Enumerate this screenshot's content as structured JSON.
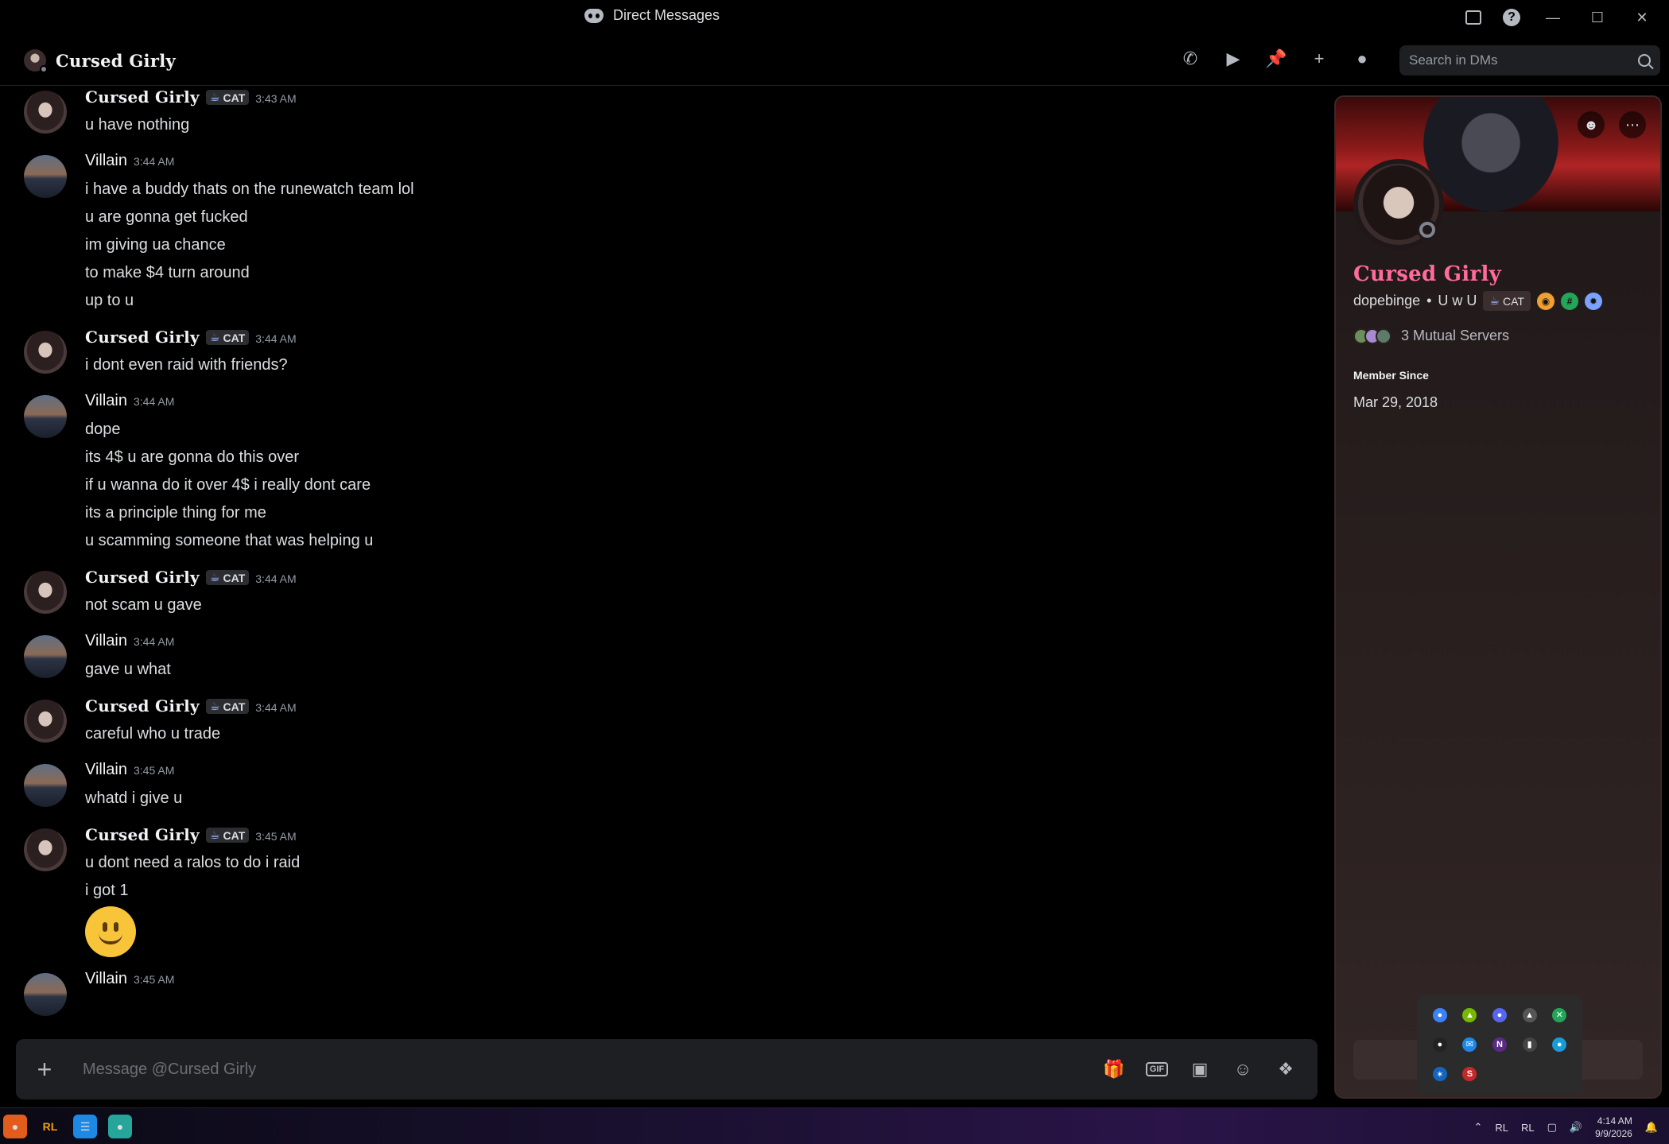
{
  "window": {
    "title": "Direct Messages"
  },
  "header": {
    "name": "Cursed Girly",
    "search_placeholder": "Search in DMs"
  },
  "messages": [
    {
      "author": "Cursed Girly",
      "kind": "cursed",
      "tag": "CAT",
      "time": "3:43 AM",
      "lines": [
        "u have nothing"
      ]
    },
    {
      "author": "Villain",
      "kind": "villain",
      "time": "3:44 AM",
      "lines": [
        "i have a buddy thats on the runewatch team lol",
        "u are gonna get fucked",
        "im giving ua chance",
        "to make $4 turn around",
        "up to u"
      ]
    },
    {
      "author": "Cursed Girly",
      "kind": "cursed",
      "tag": "CAT",
      "time": "3:44 AM",
      "lines": [
        "i dont even raid with friends?"
      ]
    },
    {
      "author": "Villain",
      "kind": "villain",
      "time": "3:44 AM",
      "lines": [
        "dope",
        "its 4$ u are gonna do this over",
        "if u wanna do it over 4$ i really dont care",
        "its a principle thing for me",
        "u scamming someone that was helping u"
      ]
    },
    {
      "author": "Cursed Girly",
      "kind": "cursed",
      "tag": "CAT",
      "time": "3:44 AM",
      "lines": [
        "not scam u gave"
      ]
    },
    {
      "author": "Villain",
      "kind": "villain",
      "time": "3:44 AM",
      "lines": [
        "gave u what"
      ]
    },
    {
      "author": "Cursed Girly",
      "kind": "cursed",
      "tag": "CAT",
      "time": "3:44 AM",
      "lines": [
        "careful who u trade"
      ]
    },
    {
      "author": "Villain",
      "kind": "villain",
      "time": "3:45 AM",
      "lines": [
        "whatd i give u"
      ]
    },
    {
      "author": "Cursed Girly",
      "kind": "cursed",
      "tag": "CAT",
      "time": "3:45 AM",
      "lines": [
        "u dont need a ralos to do i raid",
        "i got 1"
      ],
      "emoji": "slightly-smiling-face"
    },
    {
      "author": "Villain",
      "kind": "villain",
      "time": "3:45 AM",
      "lines": []
    }
  ],
  "composer": {
    "placeholder": "Message @Cursed Girly",
    "gif_label": "GIF"
  },
  "profile": {
    "display_name": "Cursed Girly",
    "username": "dopebinge",
    "pronouns": "U w U",
    "tag": "CAT",
    "mutual_servers": "3 Mutual Servers",
    "member_since_label": "Member Since",
    "member_since": "Mar 29, 2018",
    "name_color": "#ff6b9a"
  },
  "taskbar": {
    "time": "4:14 AM",
    "date": "9/9/2026"
  }
}
